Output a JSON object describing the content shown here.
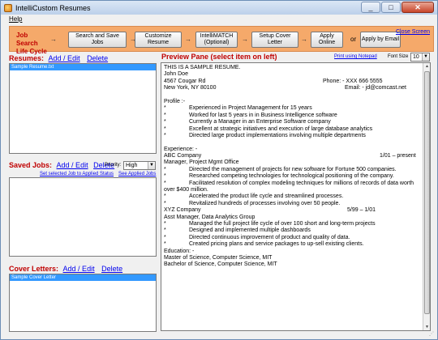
{
  "window": {
    "title": "IntelliCustom Resumes",
    "minimize": "_",
    "maximize": "□",
    "close": "✕"
  },
  "menu": {
    "help": "Help"
  },
  "toolbar": {
    "title_line1": "Job Search",
    "title_line2": "Life Cycle",
    "arrow": "→",
    "buttons": {
      "search_save": "Search and Save Jobs",
      "customize": "Customize Resume",
      "intellimatch_line1": "IntelliMATCH",
      "intellimatch_line2": "(Optional)",
      "cover_letter": "Setup Cover Letter",
      "apply_online": "Apply Online",
      "apply_email": "Apply by Email"
    },
    "or": "or",
    "close_screen": "Close Screen"
  },
  "resumes": {
    "label": "Resumes:",
    "add_edit": "Add / Edit",
    "delete": "Delete",
    "items": [
      "Sample Resume.txt"
    ]
  },
  "saved_jobs": {
    "label": "Saved Jobs:",
    "add_edit": "Add / Edit",
    "delete": "Delete",
    "priority_label": "Priority:",
    "priority_value": "High",
    "set_status": "Set selected Job to Applied Status",
    "see_applied": "See Applied Jobs"
  },
  "cover_letters": {
    "label": "Cover Letters:",
    "add_edit": "Add / Edit",
    "delete": "Delete",
    "items": [
      "Sample Cover Letter"
    ]
  },
  "preview": {
    "title": "Preview Pane (select item on left)",
    "print": "Print using Notepad",
    "font_size_label": "Font Size",
    "font_size_value": "10",
    "lines": {
      "l1": "THIS IS A SAMPLE RESUME.",
      "l2": "John Doe",
      "l3": "4567 Cougar Rd",
      "l3r": "Phone: -  XXX 666 5555",
      "l4": "New York, NY 80100",
      "l4r": "Email:  -  jd@comcast.net",
      "profile": "Profile     :-",
      "p1": "Experienced in Project Management for 15 years",
      "p2": "Worked for last 5 years in in Business Intelligence software",
      "p3": "Currently a Manager in an Enterprise Software company",
      "p4": "Excellent at strategic initiatives and execution of large database analytics",
      "p5": "Directed large product implementations involving multiple departments",
      "experience": "Experience: -",
      "abc": "ABC Company",
      "abc_dates": "1/01 – present",
      "abc_title": "Manager, Project Mgmt Office",
      "a1": "Directed the management of projects for new software for Fortune 500 companies.",
      "a2": "Researched competing technologies for technological positioning of the company.",
      "a3": "Facilitated resolution of complex modeling techniques for millions of records of data worth",
      "a3b": "over $400 million.",
      "a4": "Accelerated the product life cycle and streamlined processes.",
      "a5": "Revitalized hundreds of processes involving over 50 people.",
      "xyz": "XYZ Company",
      "xyz_dates": "5/99 – 1/01",
      "xyz_title": "Asst Manager, Data Analytics Group",
      "x1": "Managed the full project life cycle of over 100 short and long-term projects",
      "x2": "Designed and implemented multiple dashboards",
      "x3": "Directed continuous improvement of product and quality of data.",
      "x4": "Created pricing plans and service packages to up-sell existing clients.",
      "education": "Education: -",
      "e1": "Master of Science, Computer Science, MIT",
      "e2": "Bachelor of Science, Computer Science, MIT",
      "bullet": "*"
    }
  },
  "colors": {
    "accent_red": "#c00000",
    "toolbar_orange": "#f5a96a",
    "link_blue": "#0000ee",
    "selection": "#3399ff"
  }
}
